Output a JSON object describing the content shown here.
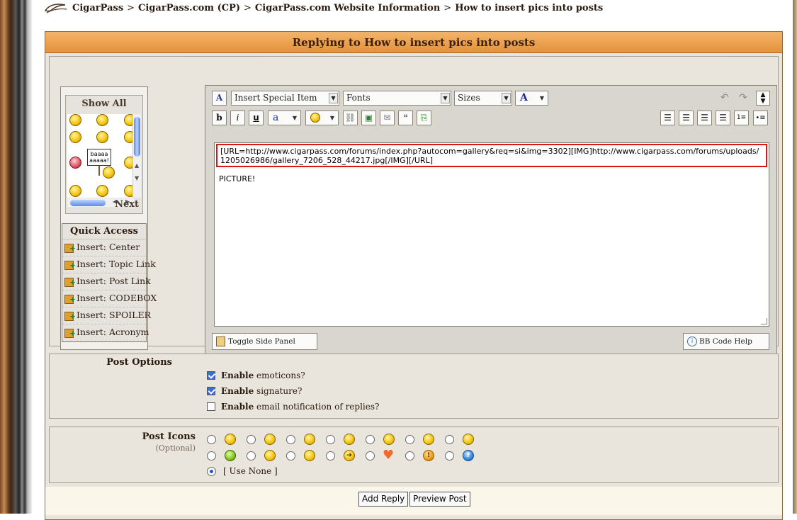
{
  "breadcrumb": {
    "items": [
      "CigarPass",
      "CigarPass.com (CP)",
      "CigarPass.com Website Information",
      "How to insert pics into posts"
    ],
    "separator": ">"
  },
  "form": {
    "title": "Replying to How to insert pics into posts"
  },
  "side_panel": {
    "show_all": "Show All",
    "next": "Next",
    "emoticon_sign_text": "baaaa aaaaa!",
    "quick_access": {
      "title": "Quick Access",
      "items": [
        "Insert: Center",
        "Insert: Topic Link",
        "Insert: Post Link",
        "Insert: CODEBOX",
        "Insert: SPOILER",
        "Insert: Acronym"
      ]
    }
  },
  "toolbar": {
    "special_item": "Insert Special Item",
    "fonts": "Fonts",
    "sizes": "Sizes",
    "color_glyph": "A",
    "bold": "b",
    "italic": "i",
    "underline": "u",
    "toggle_side_panel": "Toggle Side Panel",
    "bb_code_help": "BB Code Help"
  },
  "editor": {
    "url_code": "[URL=http://www.cigarpass.com/forums/index.php?autocom=gallery&req=si&img=3302][IMG]http://www.cigarpass.com/forums/uploads/1205026986/gallery_7206_528_44217.jpg[/IMG][/URL]",
    "body_text": "PICTURE!"
  },
  "post_options": {
    "label": "Post Options",
    "options": [
      {
        "bold": "Enable",
        "text": " emoticons?",
        "checked": true
      },
      {
        "bold": "Enable",
        "text": " signature?",
        "checked": true
      },
      {
        "bold": "Enable",
        "text": " email notification of replies?",
        "checked": false
      }
    ]
  },
  "post_icons": {
    "label": "Post Icons",
    "sublabel": "(Optional)",
    "use_none": "[ Use None ]",
    "row1_icons": [
      "smile-icon",
      "wink-icon",
      "happy-icon",
      "grin-icon",
      "surprised-icon",
      "laugh-icon",
      "angry-icon"
    ],
    "row2_icons": [
      "sick-icon",
      "confused-icon",
      "cool-icon",
      "arrow-icon",
      "heart-icon",
      "warning-icon",
      "question-icon"
    ],
    "selected": "none"
  },
  "buttons": {
    "add_reply": "Add Reply",
    "preview_post": "Preview Post"
  },
  "colors": {
    "title_bar": "#e4913c",
    "url_highlight": "#dd1515",
    "checkbox": "#3a6fd6"
  }
}
